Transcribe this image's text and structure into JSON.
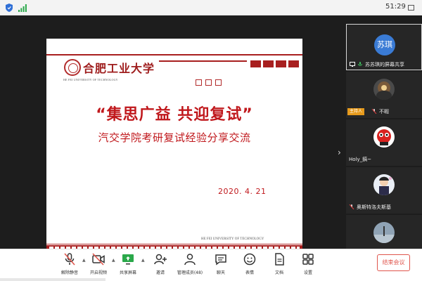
{
  "status_bar": {
    "time": "51:29",
    "icons": [
      "shield-icon",
      "signal-icon",
      "maximize-icon"
    ]
  },
  "slide": {
    "logo_cn": "合肥工业大学",
    "logo_en": "HE FEI UNIVERSITY OF TECHNOLOGY",
    "title": "“集思广益 共迎复试”",
    "subtitle": "汽交学院考研复试经验分享交流",
    "date": "2020. 4. 21",
    "footer_en": "HE FEI UNIVERSITY OF TECHNOLOGY",
    "accent_color": "#c0181c"
  },
  "nav": {
    "next_icon": "chevron-right-icon"
  },
  "participants": [
    {
      "avatar_text": "苏琪",
      "label": "苏苏琪的屏幕共享",
      "badge": "",
      "active": true
    },
    {
      "avatar_text": "",
      "label": "不暇",
      "badge": "主持人",
      "active": false
    },
    {
      "avatar_text": "",
      "label": "Holy_鎬~",
      "badge": "",
      "active": false
    },
    {
      "avatar_text": "",
      "label": "奥斯特洛夫斯基",
      "badge": "",
      "active": false
    },
    {
      "avatar_text": "",
      "label": "",
      "badge": "",
      "active": false
    }
  ],
  "toolbar": {
    "items": [
      {
        "label": "解除静音",
        "icon": "mic-muted-icon"
      },
      {
        "label": "开启视频",
        "icon": "video-off-icon"
      },
      {
        "label": "共享屏幕",
        "icon": "share-screen-icon"
      },
      {
        "label": "邀请",
        "icon": "invite-icon"
      },
      {
        "label": "管理成员(48)",
        "icon": "members-icon"
      },
      {
        "label": "聊天",
        "icon": "chat-icon"
      },
      {
        "label": "表情",
        "icon": "emoji-icon"
      },
      {
        "label": "文档",
        "icon": "document-icon"
      },
      {
        "label": "设置",
        "icon": "settings-icon"
      }
    ],
    "end_label": "结束会议",
    "end_color": "#e0554c"
  }
}
